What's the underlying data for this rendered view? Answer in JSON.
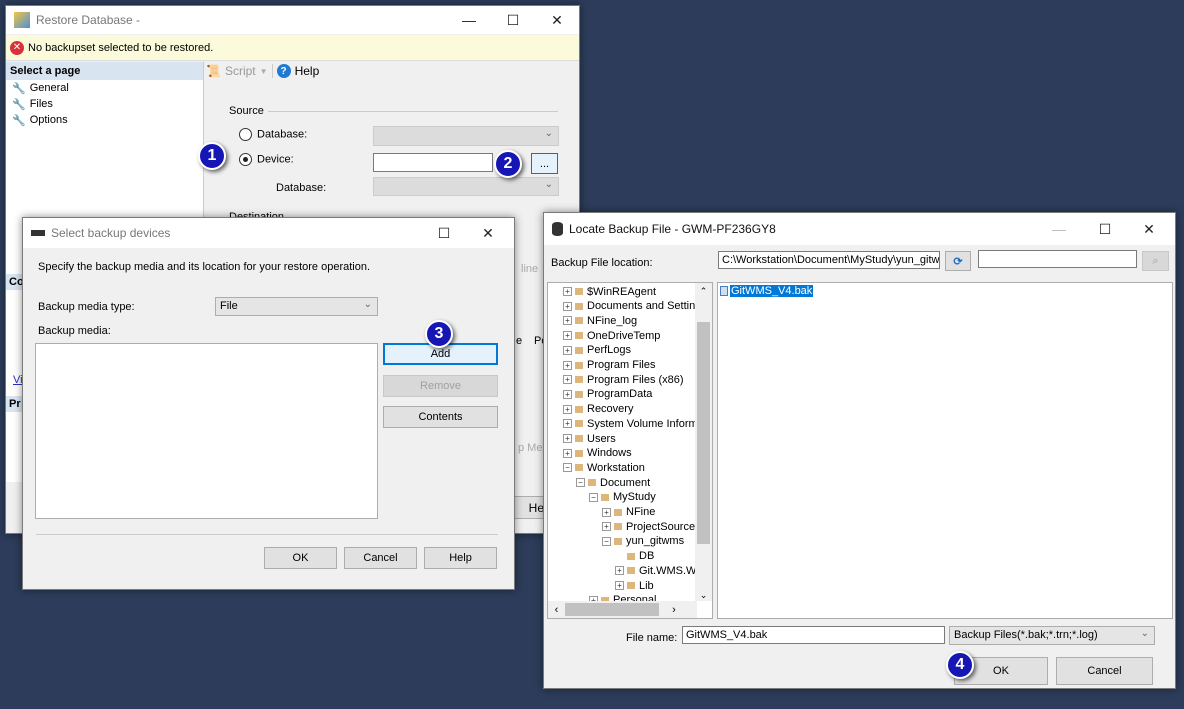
{
  "restore": {
    "title": "Restore Database -",
    "error": "No backupset selected to be restored.",
    "select_page": "Select a page",
    "pages": [
      "General",
      "Files",
      "Options"
    ],
    "script": "Script",
    "help": "Help",
    "source": "Source",
    "database_label": "Database:",
    "device_label": "Device:",
    "db_label2": "Database:",
    "destination": "Destination",
    "browse": "...",
    "partial": {
      "co": "Co",
      "vi": "Vi",
      "pr": "Pr",
      "line": "line",
      "e": "e",
      "po": "Po",
      "media": "p Me",
      "help_btn": "Help"
    }
  },
  "select_devices": {
    "title": "Select backup devices",
    "instruction": "Specify the backup media and its location for your restore operation.",
    "media_type_label": "Backup media type:",
    "media_type_value": "File",
    "media_label": "Backup media:",
    "add": "Add",
    "remove": "Remove",
    "contents": "Contents",
    "ok": "OK",
    "cancel": "Cancel",
    "help": "Help"
  },
  "locate": {
    "title": "Locate Backup File - GWM-PF236GY8",
    "location_label": "Backup File location:",
    "location_value": "C:\\Workstation\\Document\\MyStudy\\yun_gitwm",
    "search_value": "",
    "tree": [
      {
        "label": "$WinREAgent",
        "level": 0,
        "state": "+"
      },
      {
        "label": "Documents and Settin",
        "level": 0,
        "state": "+"
      },
      {
        "label": "NFine_log",
        "level": 0,
        "state": "+"
      },
      {
        "label": "OneDriveTemp",
        "level": 0,
        "state": "+"
      },
      {
        "label": "PerfLogs",
        "level": 0,
        "state": "+"
      },
      {
        "label": "Program Files",
        "level": 0,
        "state": "+"
      },
      {
        "label": "Program Files (x86)",
        "level": 0,
        "state": "+"
      },
      {
        "label": "ProgramData",
        "level": 0,
        "state": "+"
      },
      {
        "label": "Recovery",
        "level": 0,
        "state": "+"
      },
      {
        "label": "System Volume Inform",
        "level": 0,
        "state": "+"
      },
      {
        "label": "Users",
        "level": 0,
        "state": "+"
      },
      {
        "label": "Windows",
        "level": 0,
        "state": "+"
      },
      {
        "label": "Workstation",
        "level": 0,
        "state": "-"
      },
      {
        "label": "Document",
        "level": 1,
        "state": "-"
      },
      {
        "label": "MyStudy",
        "level": 2,
        "state": "-"
      },
      {
        "label": "NFine",
        "level": 3,
        "state": "+"
      },
      {
        "label": "ProjectSource",
        "level": 3,
        "state": "+"
      },
      {
        "label": "yun_gitwms",
        "level": 3,
        "state": "-"
      },
      {
        "label": "DB",
        "level": 4,
        "state": ""
      },
      {
        "label": "Git.WMS.W",
        "level": 4,
        "state": "+"
      },
      {
        "label": "Lib",
        "level": 4,
        "state": "+"
      },
      {
        "label": "Personal",
        "level": 2,
        "state": "+"
      }
    ],
    "selected_file": "GitWMS_V4.bak",
    "file_name_label": "File name:",
    "file_name_value": "GitWMS_V4.bak",
    "filter": "Backup Files(*.bak;*.trn;*.log)",
    "ok": "OK",
    "cancel": "Cancel"
  },
  "badges": [
    "1",
    "2",
    "3",
    "4"
  ],
  "colors": {
    "background": "#2c3c5a",
    "badge": "#1616b4",
    "selection": "#0078d7",
    "error_bar": "#fbfbdc"
  }
}
